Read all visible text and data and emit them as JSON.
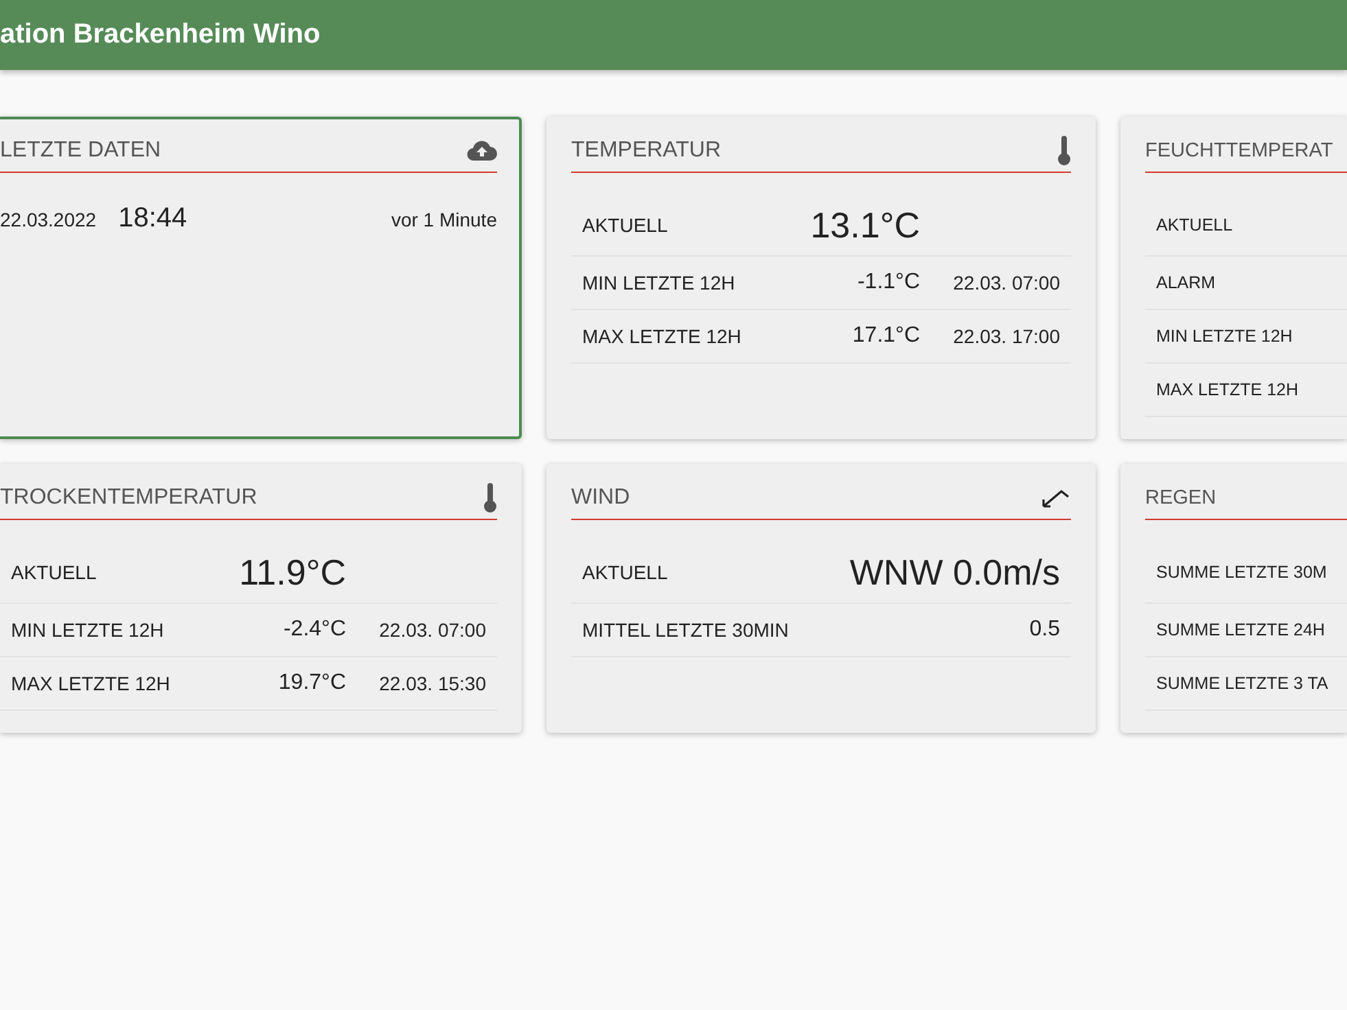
{
  "header": {
    "title": "ation Brackenheim Wino"
  },
  "cards": [
    {
      "kind": "last_data",
      "title": "LETZTE DATEN",
      "selected": true,
      "date": "22.03.2022",
      "time": "18:44",
      "ago": "vor 1 Minute"
    },
    {
      "kind": "temperature",
      "title": "TEMPERATUR",
      "selected": false,
      "rows": [
        {
          "kind": "main",
          "label": "AKTUELL",
          "value": "13.1°C"
        },
        {
          "kind": "plain",
          "label": "MIN LETZTE 12H",
          "value": "-1.1°C",
          "time": "22.03. 07:00"
        },
        {
          "kind": "plain",
          "label": "MAX LETZTE 12H",
          "value": "17.1°C",
          "time": "22.03. 17:00"
        }
      ]
    },
    {
      "kind": "plain",
      "title": "FEUCHTTEMPERAT",
      "selected": false,
      "rows": [
        {
          "kind": "plain",
          "label": "AKTUELL"
        },
        {
          "kind": "plain",
          "label": "ALARM"
        },
        {
          "kind": "plain",
          "label": "MIN LETZTE 12H"
        },
        {
          "kind": "plain",
          "label": "MAX LETZTE 12H"
        }
      ]
    },
    {
      "kind": "temperature",
      "title": "TROCKENTEMPERATUR",
      "selected": false,
      "rows": [
        {
          "kind": "main",
          "label": "AKTUELL",
          "value": "11.9°C"
        },
        {
          "kind": "plain",
          "label": "MIN LETZTE 12H",
          "value": "-2.4°C",
          "time": "22.03. 07:00"
        },
        {
          "kind": "plain",
          "label": "MAX LETZTE 12H",
          "value": "19.7°C",
          "time": "22.03. 15:30"
        }
      ]
    },
    {
      "kind": "wind",
      "title": "WIND",
      "selected": false,
      "rows": [
        {
          "kind": "main",
          "label": "AKTUELL",
          "value": "WNW 0.0m/s"
        },
        {
          "kind": "plain",
          "label": "MITTEL LETZTE 30MIN",
          "value": "0.5"
        }
      ]
    },
    {
      "kind": "plain",
      "title": "REGEN",
      "selected": false,
      "rows": [
        {
          "kind": "plain",
          "label": "SUMME LETZTE 30M"
        },
        {
          "kind": "plain",
          "label": "SUMME LETZTE 24H"
        },
        {
          "kind": "plain",
          "label": "SUMME LETZTE 3 TA"
        }
      ]
    }
  ]
}
